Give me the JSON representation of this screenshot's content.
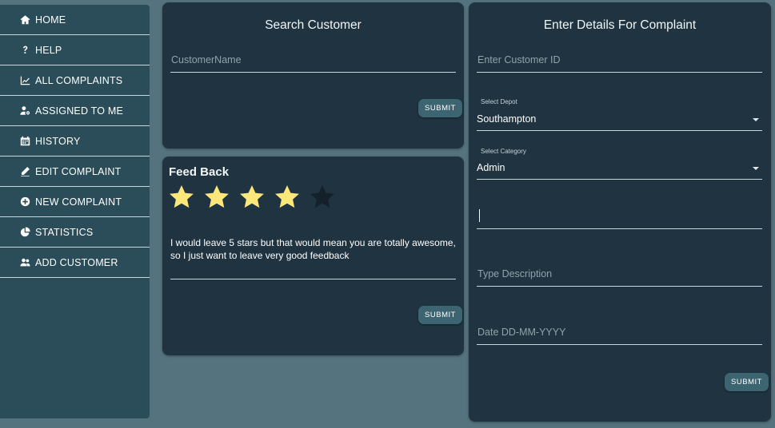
{
  "sidebar": {
    "items": [
      {
        "label": "HOME",
        "icon": "home-icon"
      },
      {
        "label": "HELP",
        "icon": "question-icon"
      },
      {
        "label": "ALL COMPLAINTS",
        "icon": "chart-line-icon"
      },
      {
        "label": "ASSIGNED TO ME",
        "icon": "user-gear-icon"
      },
      {
        "label": "HISTORY",
        "icon": "calendar-icon"
      },
      {
        "label": "EDIT COMPLAINT",
        "icon": "pencil-icon"
      },
      {
        "label": "NEW COMPLAINT",
        "icon": "plus-circle-icon"
      },
      {
        "label": "STATISTICS",
        "icon": "pie-chart-icon"
      },
      {
        "label": "ADD CUSTOMER",
        "icon": "users-icon"
      }
    ]
  },
  "search_card": {
    "title": "Search Customer",
    "customer_name_placeholder": "CustomerName",
    "submit_label": "SUBMIT"
  },
  "feedback_card": {
    "title": "Feed Back",
    "rating": 4,
    "max_rating": 5,
    "text": "I would leave 5 stars but that would mean you are totally awesome, so I just want to leave very good feedback",
    "submit_label": "SUBMIT"
  },
  "complaint_card": {
    "title": "Enter Details For Complaint",
    "customer_id_placeholder": "Enter Customer ID",
    "depot_label": "Select Depot",
    "depot_value": "Southampton",
    "category_label": "Select Category",
    "category_value": "Admin",
    "description_placeholder": "Type Description",
    "date_placeholder": "Date DD-MM-YYYY",
    "submit_label": "SUBMIT"
  },
  "colors": {
    "background": "#55737e",
    "sidebar": "#2a4d59",
    "card": "#1f3440",
    "button": "#3d6471",
    "star_filled": "#fbe77a",
    "star_empty": "#14202a"
  }
}
